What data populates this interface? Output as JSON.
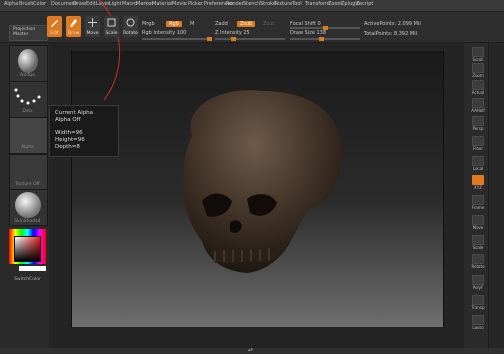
{
  "menu": [
    "Alpha",
    "Brush",
    "Color",
    "Document",
    "Draw",
    "Edit",
    "Layer",
    "Light",
    "Macro",
    "Marker",
    "Material",
    "Movie",
    "Picker",
    "Preferences",
    "Render",
    "Stencil",
    "Stroke",
    "Texture",
    "Tool",
    "Transform",
    "Zoom",
    "Zplugin",
    "Zscript"
  ],
  "left_top": {
    "projection_master": "Projection Master"
  },
  "toolbar": {
    "edit": "Edit",
    "draw": "Draw",
    "move": "Move",
    "scale": "Scale",
    "rotate": "Rotate",
    "mrgb": "Mrgb",
    "rgb": "Rgb",
    "m": "M",
    "zadd": "Zadd",
    "zsub": "Zsub",
    "zcut": "Zcut",
    "rgb_intensity": "Rgb Intensity 100",
    "z_intensity": "Z Intensity 25",
    "focal_shift": "Focal Shift 0",
    "draw_size": "Draw Size 138",
    "active_points": "ActivePoints: 2.099 Mil",
    "total_points": "TotalPoints: 8.392 Mil",
    "rgb_intensity_value": 100,
    "z_intensity_value": 25,
    "focal_shift_value": 0,
    "draw_size_value": 138
  },
  "leftpanel": {
    "brush_label": "Nudge",
    "stroke_label": "Dots",
    "alpha_label": "Alpha",
    "texture_label": "Texture Off",
    "material_label": "SkinShade4",
    "switch_color": "SwitchColor"
  },
  "tooltip": {
    "title": "Current Alpha",
    "subtitle": "Alpha Off",
    "width": "Width=96",
    "height": "Height=96",
    "depth": "Depth=8"
  },
  "rightpanel": [
    "Scroll",
    "Zoom",
    "Actual",
    "AAHalf",
    "Persp",
    "Floor",
    "Local",
    "XYZ",
    "Frame",
    "Move",
    "Scale",
    "Rotate",
    "PolyF",
    "Transp",
    "Lasso"
  ],
  "colors": {
    "accent": "#e07a20",
    "bg": "#2a2a2a"
  }
}
